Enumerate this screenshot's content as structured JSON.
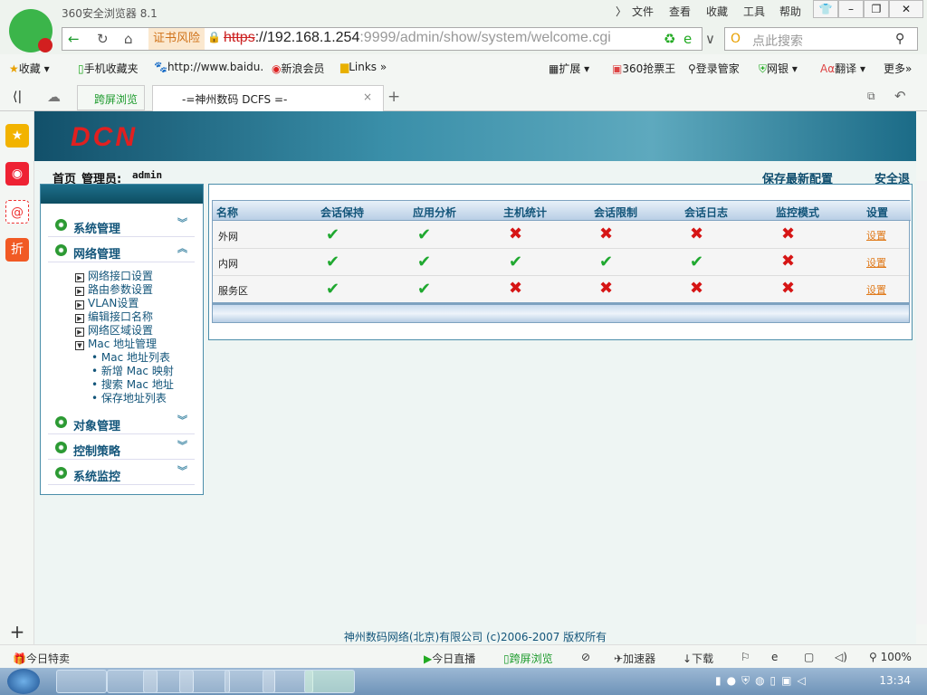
{
  "browser": {
    "title": "360安全浏览器 8.1",
    "menus": [
      "文件",
      "查看",
      "收藏",
      "工具",
      "帮助"
    ],
    "cert_warning": "证书风险",
    "url_scheme": "https",
    "url_host": "://192.168.1.254",
    "url_rest": ":9999/admin/show/system/welcome.cgi",
    "search_placeholder": "点此搜索",
    "bookmarks": [
      "收藏",
      "手机收藏夹",
      "http://www.baidu.",
      "新浪会员",
      "Links"
    ],
    "toolbar_right": [
      "扩展",
      "360抢票王",
      "登录管家",
      "网银",
      "翻译",
      "更多"
    ],
    "tab_cross": "跨屏浏览",
    "tab_title": "-=神州数码 DCFS =-"
  },
  "page": {
    "logo": "DCN",
    "home": "首页",
    "admin_label": "管理员:",
    "admin_user": "admin",
    "save_config": "保存最新配置",
    "logout": "安全退出",
    "nav": [
      {
        "label": "系统管理"
      },
      {
        "label": "网络管理"
      },
      {
        "label": "对象管理"
      },
      {
        "label": "控制策略"
      },
      {
        "label": "系统监控"
      }
    ],
    "network_sub": [
      "网络接口设置",
      "路由参数设置",
      "VLAN设置",
      "编辑接口名称",
      "网络区域设置",
      "Mac 地址管理"
    ],
    "mac_sub": [
      "Mac 地址列表",
      "新增 Mac 映射",
      "搜索 Mac 地址",
      "保存地址列表"
    ],
    "table": {
      "headers": [
        "名称",
        "会话保持",
        "应用分析",
        "主机统计",
        "会话限制",
        "会话日志",
        "监控模式",
        "设置"
      ],
      "rows": [
        {
          "name": "外网",
          "flags": [
            true,
            true,
            false,
            false,
            false,
            false
          ],
          "action": "设置"
        },
        {
          "name": "内网",
          "flags": [
            true,
            true,
            true,
            true,
            true,
            false
          ],
          "action": "设置"
        },
        {
          "name": "服务区",
          "flags": [
            true,
            true,
            false,
            false,
            false,
            false
          ],
          "action": "设置"
        }
      ]
    },
    "footer": "神州数码网络(北京)有限公司 (c)2006-2007 版权所有"
  },
  "status": {
    "today_sale": "今日特卖",
    "live": "今日直播",
    "cross": "跨屏浏览",
    "accel": "加速器",
    "download": "下载",
    "zoom": "100%"
  },
  "taskbar": {
    "clock": "13:34"
  }
}
